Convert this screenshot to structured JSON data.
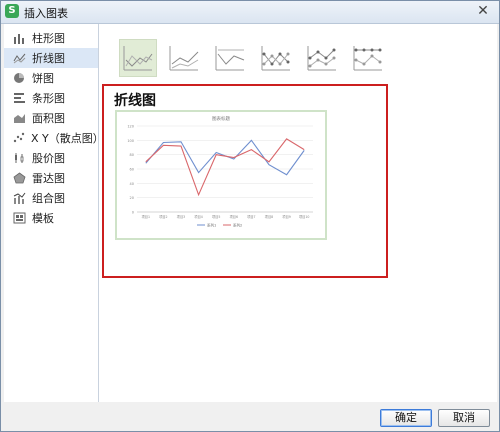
{
  "window": {
    "title": "插入图表"
  },
  "sidebar": {
    "items": [
      {
        "label": "柱形图",
        "icon": "column-chart-icon"
      },
      {
        "label": "折线图",
        "icon": "line-chart-icon",
        "active": true
      },
      {
        "label": "饼图",
        "icon": "pie-chart-icon"
      },
      {
        "label": "条形图",
        "icon": "bar-chart-icon"
      },
      {
        "label": "面积图",
        "icon": "area-chart-icon"
      },
      {
        "label": "X Y（散点图）",
        "icon": "scatter-chart-icon"
      },
      {
        "label": "股价图",
        "icon": "stock-chart-icon"
      },
      {
        "label": "雷达图",
        "icon": "radar-chart-icon"
      },
      {
        "label": "组合图",
        "icon": "combo-chart-icon"
      },
      {
        "label": "模板",
        "icon": "template-icon"
      }
    ]
  },
  "preview": {
    "heading": "折线图",
    "selected_subtype": 0
  },
  "chart_data": {
    "type": "line",
    "title": "图表标题",
    "categories": [
      "项目1",
      "项目2",
      "项目3",
      "项目4",
      "项目5",
      "项目6",
      "项目7",
      "项目8",
      "项目9",
      "项目10"
    ],
    "series": [
      {
        "name": "系列1",
        "color": "#6f8fcf",
        "values": [
          68,
          97,
          98,
          55,
          83,
          74,
          100,
          66,
          52,
          86
        ]
      },
      {
        "name": "系列2",
        "color": "#d9676b",
        "values": [
          70,
          93,
          92,
          24,
          80,
          76,
          87,
          70,
          102,
          87
        ]
      }
    ],
    "ylim": [
      0,
      120
    ],
    "yticks": [
      0,
      20,
      40,
      60,
      80,
      100,
      120
    ],
    "grid": true,
    "legend_position": "bottom"
  },
  "buttons": {
    "ok": "确定",
    "cancel": "取消"
  }
}
